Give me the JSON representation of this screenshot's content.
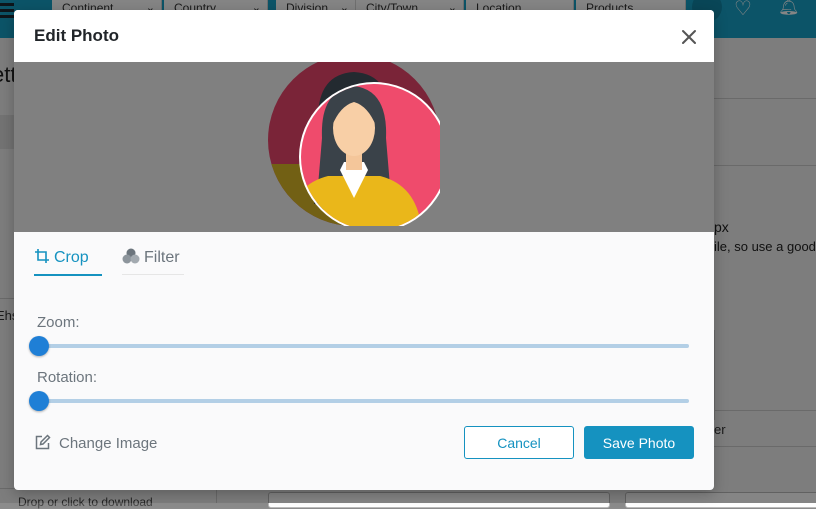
{
  "background": {
    "filters": [
      {
        "label": "Continent",
        "has_chevron": true
      },
      {
        "label": "Country",
        "has_chevron": true
      },
      {
        "label": "Division",
        "has_chevron": true
      },
      {
        "label": "City/Town",
        "has_chevron": true
      },
      {
        "label": "Location",
        "has_chevron": false
      },
      {
        "label": "Products",
        "has_chevron": false
      }
    ],
    "page_title_fragment": "ett",
    "left_label_fragment": "Ehs",
    "right_text_1": "px",
    "right_text_2": "ile, so use a good",
    "right_text_3": "er",
    "left_bottom_text": "Drop or click to download"
  },
  "modal": {
    "title": "Edit Photo",
    "tabs": [
      {
        "label": "Crop",
        "icon": "crop-icon",
        "active": true
      },
      {
        "label": "Filter",
        "icon": "filter-icon",
        "active": false
      }
    ],
    "zoom": {
      "label": "Zoom:",
      "value": 0
    },
    "rotation": {
      "label": "Rotation:",
      "value": 0
    },
    "change_image_label": "Change Image",
    "cancel_label": "Cancel",
    "save_label": "Save Photo"
  },
  "colors": {
    "accent": "#1592c0",
    "topbar": "#17a2c8",
    "slider_thumb": "#1f7fd6",
    "slider_track": "#b3cfe6",
    "avatar_bg": "#ef4b6c",
    "avatar_shirt": "#eab71a"
  }
}
